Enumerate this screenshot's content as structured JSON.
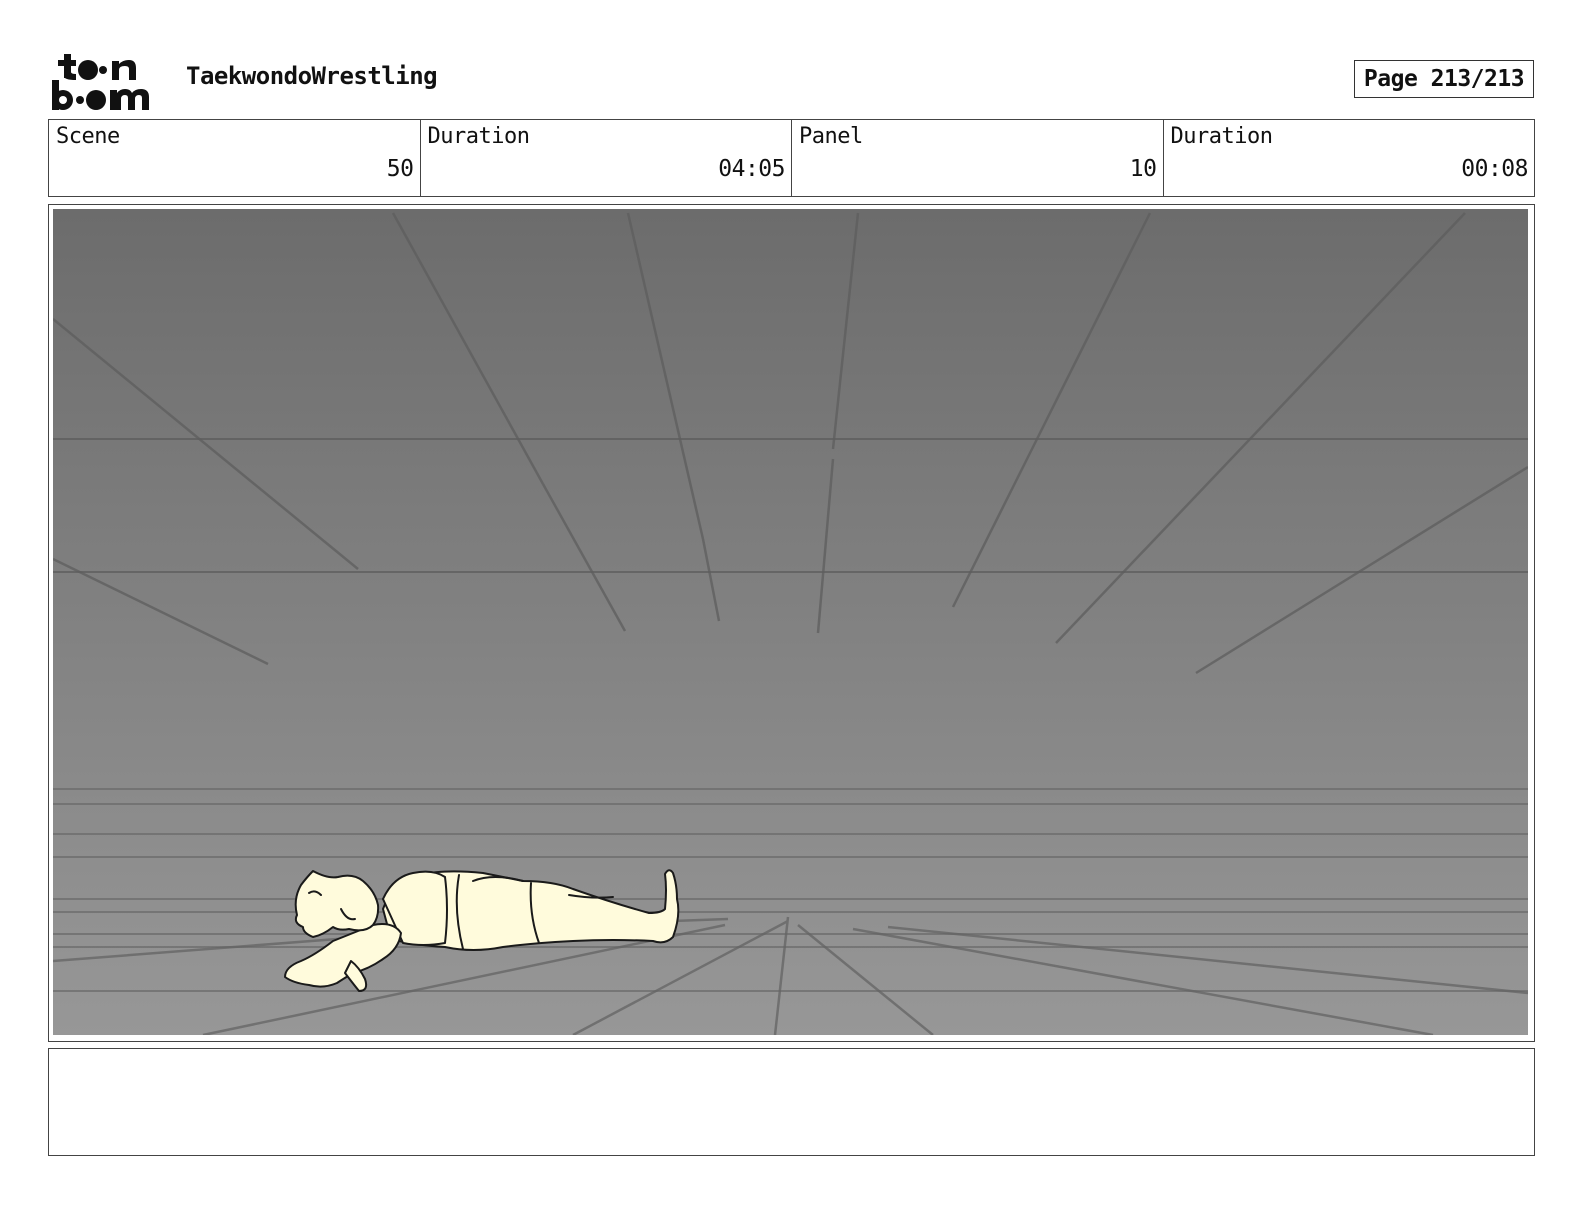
{
  "header": {
    "logo_text": "toon boom",
    "project_title": "TaekwondoWrestling",
    "page_label": "Page 213/213"
  },
  "info": [
    {
      "label": "Scene",
      "value": "50"
    },
    {
      "label": "Duration",
      "value": "04:05"
    },
    {
      "label": "Panel",
      "value": "10"
    },
    {
      "label": "Duration",
      "value": "00:08"
    }
  ],
  "panel": {
    "description": "",
    "colors": {
      "background_top": "#6c6c6c",
      "background_bottom": "#979797",
      "figure_fill": "#fffbdc",
      "line": "#555555"
    }
  },
  "notes": {
    "text": ""
  }
}
